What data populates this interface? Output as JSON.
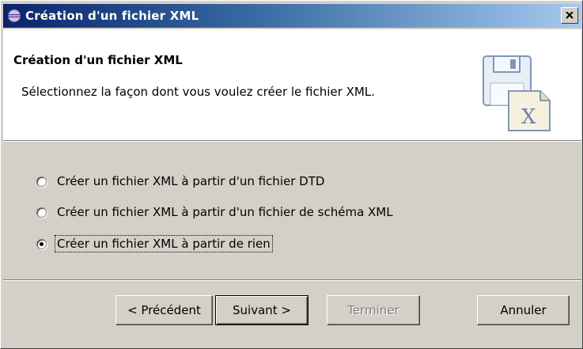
{
  "window": {
    "title": "Création d'un fichier XML",
    "close_label": "×"
  },
  "header": {
    "title": "Création d'un fichier XML",
    "description": "Sélectionnez la façon dont vous voulez créer le fichier XML.",
    "image_icon": "xml-document-wizard-icon"
  },
  "options": [
    {
      "label": "Créer un fichier XML à partir d'un fichier DTD",
      "selected": false
    },
    {
      "label": "Créer un fichier XML à partir d'un fichier de schéma XML",
      "selected": false
    },
    {
      "label": "Créer un fichier XML à partir de rien",
      "selected": true
    }
  ],
  "buttons": {
    "back_label": "< Précédent",
    "next_label": "Suivant >",
    "finish_label": "Terminer",
    "cancel_label": "Annuler"
  }
}
